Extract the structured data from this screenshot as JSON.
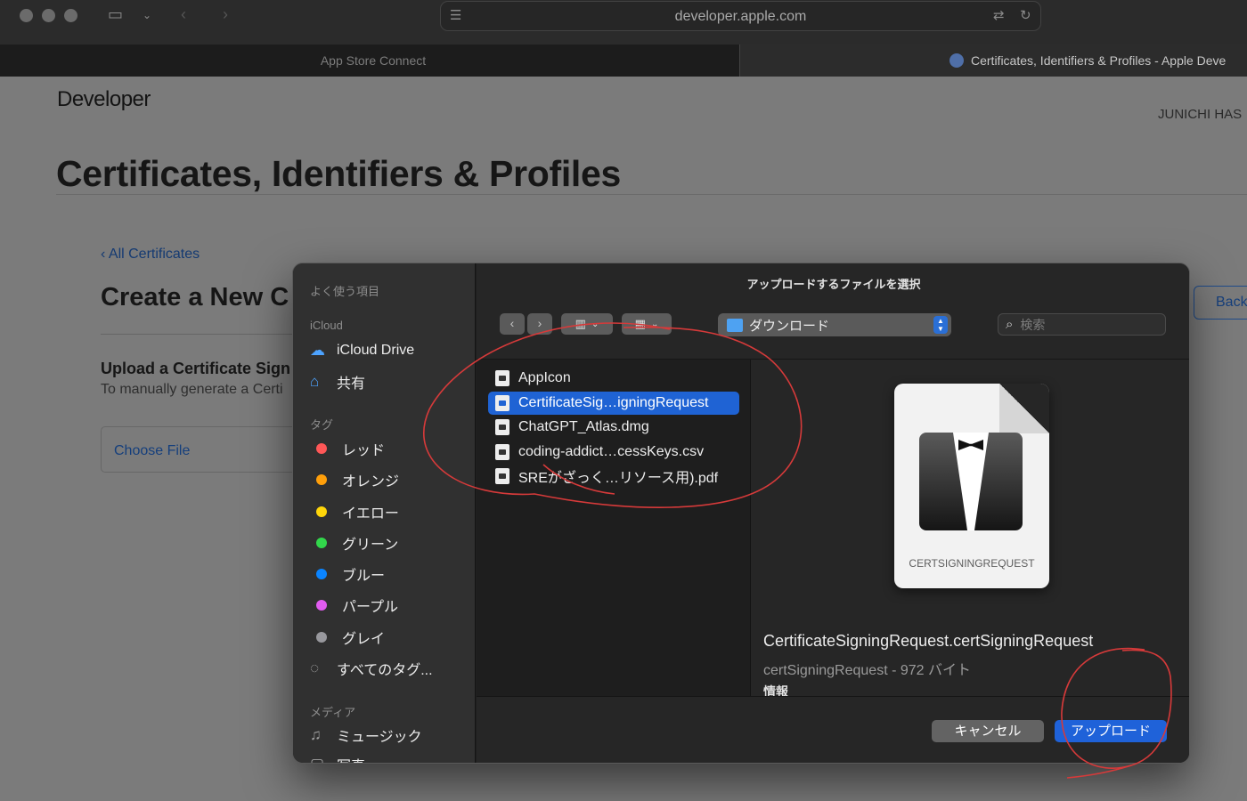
{
  "browser": {
    "url": "developer.apple.com",
    "tabs": [
      {
        "label": "App Store Connect"
      },
      {
        "label": "Certificates, Identifiers & Profiles - Apple Deve"
      }
    ]
  },
  "page": {
    "logo": "Developer",
    "user": "JUNICHI HAS",
    "title": "Certificates, Identifiers & Profiles",
    "breadcrumb": "‹ All Certificates",
    "heading": "Create a New C",
    "upload_title": "Upload a Certificate Sign",
    "upload_desc": "To manually generate a Certi",
    "choose_file": "Choose File",
    "back_button": "Back"
  },
  "dialog": {
    "title": "アップロードするファイルを選択",
    "location": "ダウンロード",
    "search_placeholder": "検索",
    "sidebar": {
      "favorites_header": "よく使う項目",
      "icloud_header": "iCloud",
      "icloud_items": [
        {
          "label": "iCloud Drive",
          "icon": "cloud-icon"
        },
        {
          "label": "共有",
          "icon": "shared-folder-icon"
        }
      ],
      "tags_header": "タグ",
      "tags": [
        {
          "label": "レッド",
          "color": "#ff5757"
        },
        {
          "label": "オレンジ",
          "color": "#ff9f0a"
        },
        {
          "label": "イエロー",
          "color": "#ffd60a"
        },
        {
          "label": "グリーン",
          "color": "#32d74b"
        },
        {
          "label": "ブルー",
          "color": "#0a84ff"
        },
        {
          "label": "パープル",
          "color": "#e15cf0"
        },
        {
          "label": "グレイ",
          "color": "#98989d"
        }
      ],
      "all_tags": "すべてのタグ...",
      "media_header": "メディア",
      "media_items": [
        {
          "label": "ミュージック",
          "icon": "music-note-icon"
        },
        {
          "label": "写真",
          "icon": "photos-icon"
        }
      ]
    },
    "files": [
      {
        "name": "AppIcon",
        "selected": false
      },
      {
        "name": "CertificateSig…igningRequest",
        "selected": true
      },
      {
        "name": "ChatGPT_Atlas.dmg",
        "selected": false
      },
      {
        "name": "coding-addict…cessKeys.csv",
        "selected": false
      },
      {
        "name": "SREがざっく…リソース用).pdf",
        "selected": false
      }
    ],
    "preview": {
      "doc_label": "CERTSIGNINGREQUEST",
      "filename": "CertificateSigningRequest.certSigningRequest",
      "meta": "certSigningRequest - 972 バイト",
      "info_label": "情報"
    },
    "cancel_button": "キャンセル",
    "upload_button": "アップロード"
  }
}
